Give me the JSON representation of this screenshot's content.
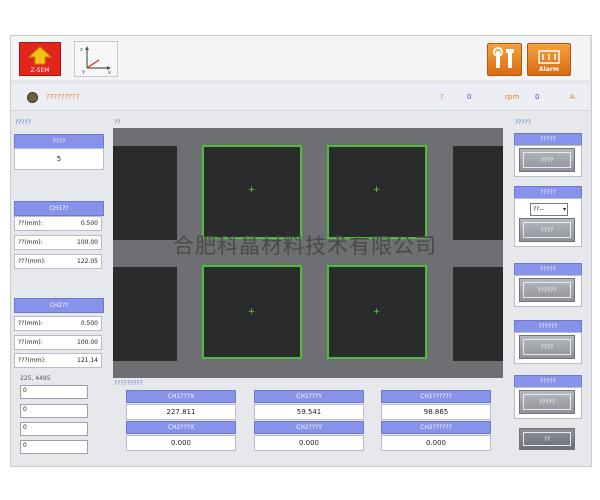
{
  "toolbar": {
    "logo_label": "Z-SEM",
    "alarm_label": "Alarm"
  },
  "status": {
    "message": "?????????",
    "mid_label": "?",
    "mid_value": "0",
    "rpm_label": "rpm",
    "rpm_value": "0",
    "alert_glyph": "A"
  },
  "left_panel": {
    "title": "?????",
    "seq_header": "????",
    "seq_value": "5",
    "ch1": {
      "header": "CH1??",
      "rows": [
        {
          "label": "??(mm):",
          "value": "0.500"
        },
        {
          "label": "??(mm):",
          "value": "100.00"
        },
        {
          "label": "???(mm):",
          "value": "122.05"
        }
      ]
    },
    "ch2": {
      "header": "CH2??",
      "rows": [
        {
          "label": "??(mm):",
          "value": "0.500"
        },
        {
          "label": "??(mm):",
          "value": "100.00"
        },
        {
          "label": "???(mm):",
          "value": "121.14"
        }
      ]
    },
    "coord_text": "225, 4495",
    "inputs": [
      "0",
      "0",
      "0",
      "0"
    ]
  },
  "center": {
    "image_title": "??",
    "bottom_title": "?????????",
    "watermark": "合肥科晶材料技术有限公司",
    "readouts": [
      {
        "label": "CH1???X",
        "value": "227.811"
      },
      {
        "label": "CH1???Y",
        "value": "59.541"
      },
      {
        "label": "CH1??????",
        "value": "98.865"
      },
      {
        "label": "CH2???X",
        "value": "0.000"
      },
      {
        "label": "CH2???Y",
        "value": "0.000"
      },
      {
        "label": "CH2??????",
        "value": "0.000"
      }
    ]
  },
  "right_panel": {
    "title": "?????",
    "groups": [
      {
        "header": "?????",
        "button": "????"
      },
      {
        "header": "?????",
        "select": "??--",
        "button": "????"
      },
      {
        "header": "?????",
        "button": "??????"
      },
      {
        "header": "??????",
        "button": "????"
      },
      {
        "header": "?????",
        "button": "?????"
      }
    ],
    "exit_label": "??"
  },
  "colors": {
    "accent": "#8792ea",
    "mark_green": "#4fbf3a",
    "orange": "#e68a25",
    "logo_red": "#e3261c"
  }
}
